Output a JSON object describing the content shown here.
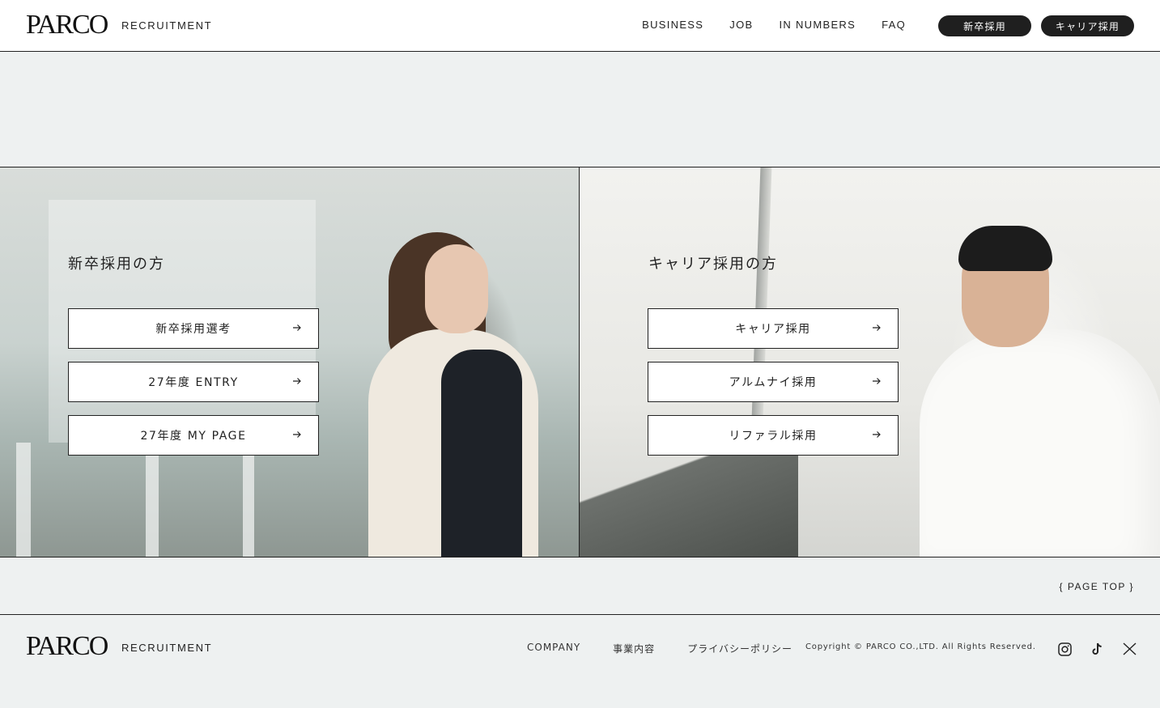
{
  "header": {
    "logo": "PARCO",
    "subtitle": "RECRUITMENT",
    "nav": [
      "BUSINESS",
      "JOB",
      "IN NUMBERS",
      "FAQ"
    ],
    "pill_new": "新卒採用",
    "pill_career": "キャリア採用"
  },
  "panels": {
    "new_grad": {
      "title": "新卒採用の方",
      "buttons": [
        "新卒採用選考",
        "27年度 ENTRY",
        "27年度 MY PAGE"
      ]
    },
    "career": {
      "title": "キャリア採用の方",
      "buttons": [
        "キャリア採用",
        "アルムナイ採用",
        "リファラル採用"
      ]
    }
  },
  "page_top": "{ PAGE TOP }",
  "footer": {
    "logo": "PARCO",
    "subtitle": "RECRUITMENT",
    "links": [
      "COMPANY",
      "事業内容",
      "プライバシーポリシー"
    ],
    "copyright": "Copyright © PARCO CO.,LTD. All Rights Reserved.",
    "socials": [
      "instagram-icon",
      "tiktok-icon",
      "x-icon"
    ]
  }
}
